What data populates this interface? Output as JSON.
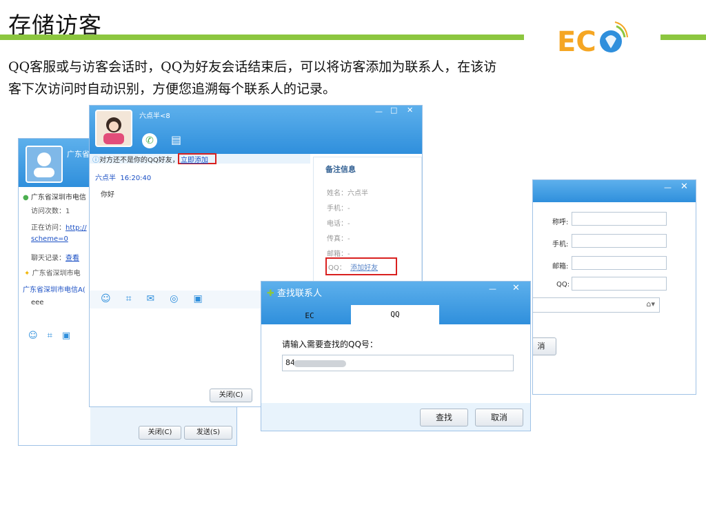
{
  "slide": {
    "title": "存储访客",
    "line1": "QQ客服或与访客会话时，QQ为好友会话结束后，可以将访客添加为联系人，在该访",
    "line2": "客下次访问时自动识别，方便您追溯每个联系人的记录。"
  },
  "logo": {
    "text": "EC",
    "color_primary": "#f5a623",
    "color_secondary": "#2f8fdc"
  },
  "colors": {
    "accent_green": "#8cc63f",
    "titlebar_blue": "#2f8fdc",
    "highlight_red": "#d9201f"
  },
  "back_window": {
    "header_name": "广东省",
    "location": "广东省深圳市电信",
    "visit_count": "访问次数：1",
    "visiting_label": "正在访问：",
    "visiting_link": "http://",
    "scheme_link": "scheme=0",
    "chat_record_label": "聊天记录：",
    "chat_record_link": "查看",
    "hint_line": "广东省深圳市电",
    "source_line": "广东省深圳市电信A(",
    "message": "eee",
    "close_label": "关闭(C)",
    "send_label": "发送(S)"
  },
  "chat_window": {
    "contact_name": "六点半<8",
    "notice": "对方还不是你的QQ好友，",
    "add_now": "立即添加",
    "msg_sender": "六点半",
    "msg_time": "16:20:40",
    "msg_text": "你好",
    "close_label": "关闭(C)",
    "notes_title": "备注信息",
    "notes": [
      "姓名：六点半",
      "手机：-",
      "电话：-",
      "传真：-",
      "邮箱：-"
    ],
    "qq_label": "QQ：",
    "add_friend": "添加好友"
  },
  "right_window": {
    "fields": [
      "称呼:",
      "手机:",
      "邮箱:",
      "QQ:"
    ],
    "cancel_partial": "消"
  },
  "find_dialog": {
    "title": "查找联系人",
    "tabs": [
      "EC",
      "QQ"
    ],
    "prompt": "请输入需要查找的QQ号：",
    "input_value": "84",
    "find_label": "查找",
    "cancel_label": "取消"
  }
}
